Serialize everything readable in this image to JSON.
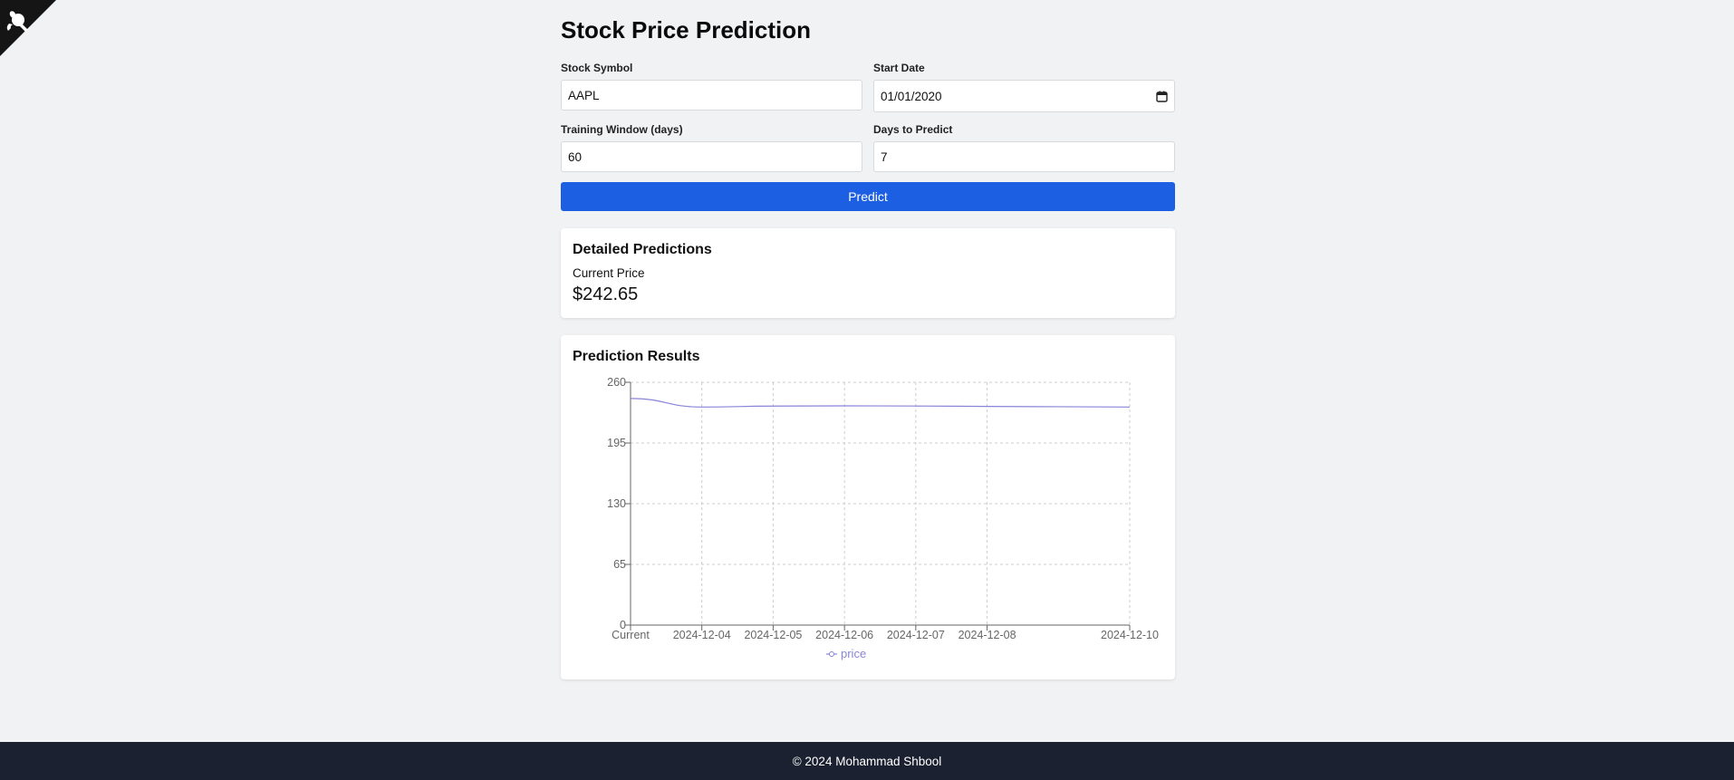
{
  "page": {
    "title": "Stock Price Prediction"
  },
  "form": {
    "symbol_label": "Stock Symbol",
    "symbol_value": "AAPL",
    "start_date_label": "Start Date",
    "start_date_value": "01/01/2020",
    "window_label": "Training Window (days)",
    "window_value": "60",
    "days_label": "Days to Predict",
    "days_value": "7",
    "predict_label": "Predict"
  },
  "details": {
    "title": "Detailed Predictions",
    "current_price_label": "Current Price",
    "current_price_value": "$242.65"
  },
  "results": {
    "title": "Prediction Results"
  },
  "chart_data": {
    "type": "line",
    "x": [
      "Current",
      "2024-12-04",
      "2024-12-05",
      "2024-12-06",
      "2024-12-07",
      "2024-12-08",
      "2024-12-10"
    ],
    "series": [
      {
        "name": "price",
        "values": [
          242.65,
          233.5,
          234.5,
          234.8,
          234.6,
          234.2,
          233.5
        ]
      }
    ],
    "ylim": [
      0,
      260
    ],
    "yticks": [
      0,
      65,
      130,
      195,
      260
    ],
    "grid": true,
    "legend": "bottom",
    "colors": {
      "line": "#8884d8",
      "grid": "#cccccc",
      "axis": "#666666"
    }
  },
  "footer": {
    "text": "© 2024 Mohammad Shbool"
  },
  "icons": {
    "corner": "github-corner-icon",
    "calendar": "calendar-icon"
  },
  "colors": {
    "primary": "#1d5fe3",
    "background": "#f1f2f4",
    "footer": "#1b2130"
  }
}
